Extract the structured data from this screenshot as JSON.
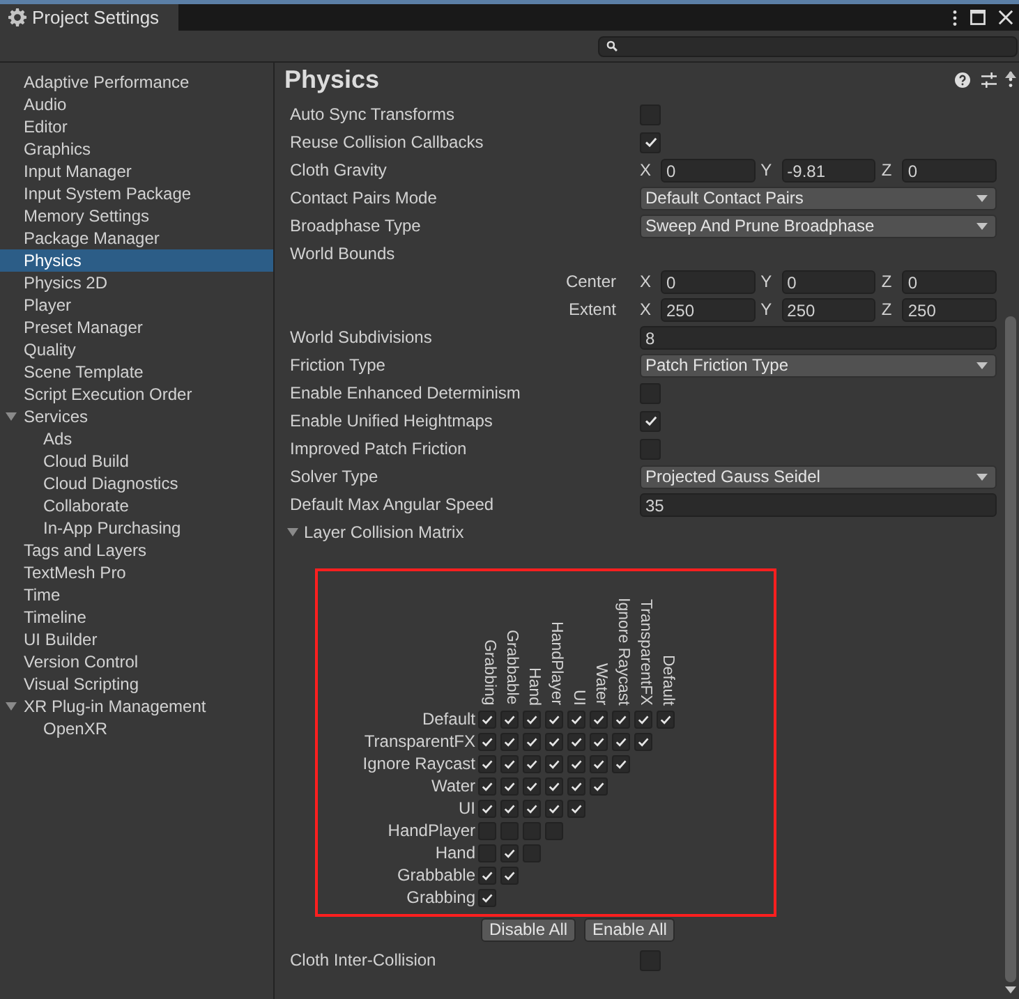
{
  "window": {
    "title": "Project Settings"
  },
  "sidebar": {
    "items": [
      {
        "label": "Adaptive Performance",
        "selected": false
      },
      {
        "label": "Audio",
        "selected": false
      },
      {
        "label": "Editor",
        "selected": false
      },
      {
        "label": "Graphics",
        "selected": false
      },
      {
        "label": "Input Manager",
        "selected": false
      },
      {
        "label": "Input System Package",
        "selected": false
      },
      {
        "label": "Memory Settings",
        "selected": false
      },
      {
        "label": "Package Manager",
        "selected": false
      },
      {
        "label": "Physics",
        "selected": true
      },
      {
        "label": "Physics 2D",
        "selected": false
      },
      {
        "label": "Player",
        "selected": false
      },
      {
        "label": "Preset Manager",
        "selected": false
      },
      {
        "label": "Quality",
        "selected": false
      },
      {
        "label": "Scene Template",
        "selected": false
      },
      {
        "label": "Script Execution Order",
        "selected": false
      },
      {
        "label": "Services",
        "selected": false,
        "expanded": true,
        "children": [
          {
            "label": "Ads",
            "selected": false
          },
          {
            "label": "Cloud Build",
            "selected": false
          },
          {
            "label": "Cloud Diagnostics",
            "selected": false
          },
          {
            "label": "Collaborate",
            "selected": false
          },
          {
            "label": "In-App Purchasing",
            "selected": false
          }
        ]
      },
      {
        "label": "Tags and Layers",
        "selected": false
      },
      {
        "label": "TextMesh Pro",
        "selected": false
      },
      {
        "label": "Time",
        "selected": false
      },
      {
        "label": "Timeline",
        "selected": false
      },
      {
        "label": "UI Builder",
        "selected": false
      },
      {
        "label": "Version Control",
        "selected": false
      },
      {
        "label": "Visual Scripting",
        "selected": false
      },
      {
        "label": "XR Plug-in Management",
        "selected": false,
        "expanded": true,
        "children": [
          {
            "label": "OpenXR",
            "selected": false
          }
        ]
      }
    ]
  },
  "page": {
    "title": "Physics"
  },
  "settings": [
    {
      "kind": "checkbox",
      "label": "Auto Sync Transforms",
      "checked": false
    },
    {
      "kind": "checkbox",
      "label": "Reuse Collision Callbacks",
      "checked": true
    },
    {
      "kind": "vector",
      "label": "Cloth Gravity",
      "axes": [
        {
          "axis": "X",
          "value": "0"
        },
        {
          "axis": "Y",
          "value": "-9.81"
        },
        {
          "axis": "Z",
          "value": "0"
        }
      ]
    },
    {
      "kind": "dropdown",
      "label": "Contact Pairs Mode",
      "value": "Default Contact Pairs"
    },
    {
      "kind": "dropdown",
      "label": "Broadphase Type",
      "value": "Sweep And Prune Broadphase"
    },
    {
      "kind": "header",
      "label": "World Bounds"
    },
    {
      "kind": "subvector",
      "label": "Center",
      "axes": [
        {
          "axis": "X",
          "value": "0"
        },
        {
          "axis": "Y",
          "value": "0"
        },
        {
          "axis": "Z",
          "value": "0"
        }
      ]
    },
    {
      "kind": "subvector",
      "label": "Extent",
      "axes": [
        {
          "axis": "X",
          "value": "250"
        },
        {
          "axis": "Y",
          "value": "250"
        },
        {
          "axis": "Z",
          "value": "250"
        }
      ]
    },
    {
      "kind": "number",
      "label": "World Subdivisions",
      "value": "8"
    },
    {
      "kind": "dropdown",
      "label": "Friction Type",
      "value": "Patch Friction Type"
    },
    {
      "kind": "checkbox",
      "label": "Enable Enhanced Determinism",
      "checked": false
    },
    {
      "kind": "checkbox",
      "label": "Enable Unified Heightmaps",
      "checked": true
    },
    {
      "kind": "checkbox",
      "label": "Improved Patch Friction",
      "checked": false
    },
    {
      "kind": "dropdown",
      "label": "Solver Type",
      "value": "Projected Gauss Seidel"
    },
    {
      "kind": "number",
      "label": "Default Max Angular Speed",
      "value": "35"
    },
    {
      "kind": "foldout",
      "label": "Layer Collision Matrix",
      "expanded": true
    }
  ],
  "matrix": {
    "columns": [
      "Grabbing",
      "Grabbable",
      "Hand",
      "HandPlayer",
      "UI",
      "Water",
      "Ignore Raycast",
      "TransparentFX",
      "Default"
    ],
    "rows": [
      {
        "label": "Default",
        "cells": [
          true,
          true,
          true,
          true,
          true,
          true,
          true,
          true,
          true
        ]
      },
      {
        "label": "TransparentFX",
        "cells": [
          true,
          true,
          true,
          true,
          true,
          true,
          true,
          true
        ]
      },
      {
        "label": "Ignore Raycast",
        "cells": [
          true,
          true,
          true,
          true,
          true,
          true,
          true
        ]
      },
      {
        "label": "Water",
        "cells": [
          true,
          true,
          true,
          true,
          true,
          true
        ]
      },
      {
        "label": "UI",
        "cells": [
          true,
          true,
          true,
          true,
          true
        ]
      },
      {
        "label": "HandPlayer",
        "cells": [
          false,
          false,
          false,
          false
        ]
      },
      {
        "label": "Hand",
        "cells": [
          false,
          true,
          false
        ]
      },
      {
        "label": "Grabbable",
        "cells": [
          true,
          true
        ]
      },
      {
        "label": "Grabbing",
        "cells": [
          true
        ]
      }
    ],
    "buttons": [
      "Disable All",
      "Enable All"
    ]
  },
  "settings_after": [
    {
      "kind": "checkbox",
      "label": "Cloth Inter-Collision",
      "checked": false
    }
  ]
}
